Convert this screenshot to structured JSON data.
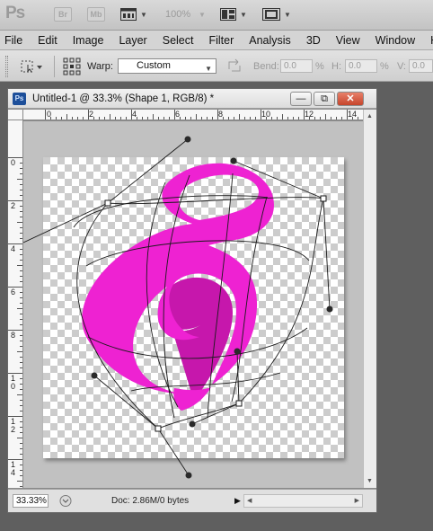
{
  "app": {
    "logo": "Ps",
    "bridge_label": "Br",
    "mini_label": "Mb",
    "zoom": "100%"
  },
  "menu": [
    "File",
    "Edit",
    "Image",
    "Layer",
    "Select",
    "Filter",
    "Analysis",
    "3D",
    "View",
    "Window",
    "He"
  ],
  "options": {
    "warp_label": "Warp:",
    "warp_value": "Custom",
    "bend_label": "Bend:",
    "bend_value": "0.0",
    "bend_unit": "%",
    "h_label": "H:",
    "h_value": "0.0",
    "h_unit": "%",
    "v_label": "V:",
    "v_value": "0.0"
  },
  "document": {
    "icon": "Ps",
    "title": "Untitled-1 @ 33.3% (Shape 1, RGB/8) *",
    "minimize_glyph": "—",
    "restore_glyph": "⧉",
    "close_glyph": "✕",
    "ruler_top_numbers": [
      "0",
      "2",
      "4",
      "6",
      "8",
      "10",
      "12",
      "14"
    ],
    "ruler_left_numbers": [
      "0",
      "2",
      "4",
      "6",
      "8",
      "10",
      "12",
      "14"
    ],
    "zoom_field": "33.33%",
    "doc_info": "Doc: 2.86M/0 bytes"
  },
  "colors": {
    "shape": "#ee22d2",
    "shape_shadow": "#c617ac"
  }
}
